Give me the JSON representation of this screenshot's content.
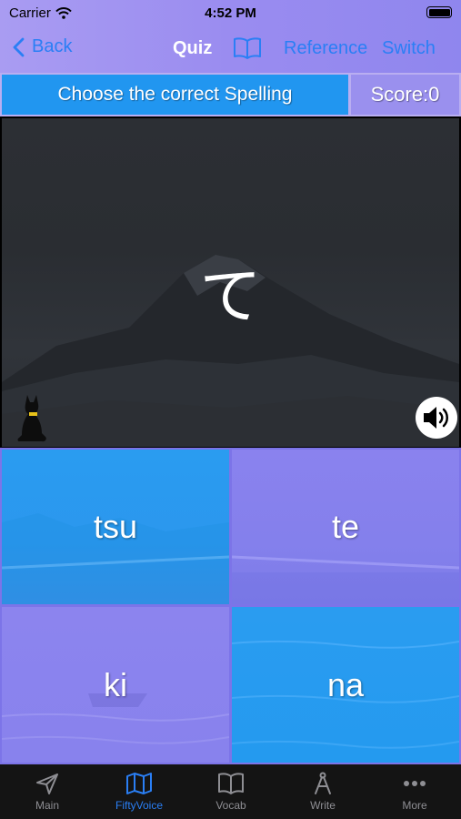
{
  "status_bar": {
    "carrier": "Carrier",
    "time": "4:52 PM"
  },
  "nav": {
    "back_label": "Back",
    "title": "Quiz",
    "reference_label": "Reference",
    "switch_label": "Switch"
  },
  "quiz": {
    "prompt": "Choose the correct Spelling",
    "score": "Score:0",
    "kana": "て",
    "answers": [
      "tsu",
      "te",
      "ki",
      "na"
    ]
  },
  "tabs": [
    {
      "label": "Main",
      "icon": "paper-plane-icon"
    },
    {
      "label": "FiftyVoice",
      "icon": "map-icon",
      "active": true
    },
    {
      "label": "Vocab",
      "icon": "open-book-icon"
    },
    {
      "label": "Write",
      "icon": "compass-pen-icon"
    },
    {
      "label": "More",
      "icon": "ellipsis-icon"
    }
  ],
  "colors": {
    "accent": "#2a7ff5",
    "answer_blue": "#2196f0",
    "answer_violet": "#8a82ee",
    "header_violet": "#9a90ee"
  }
}
